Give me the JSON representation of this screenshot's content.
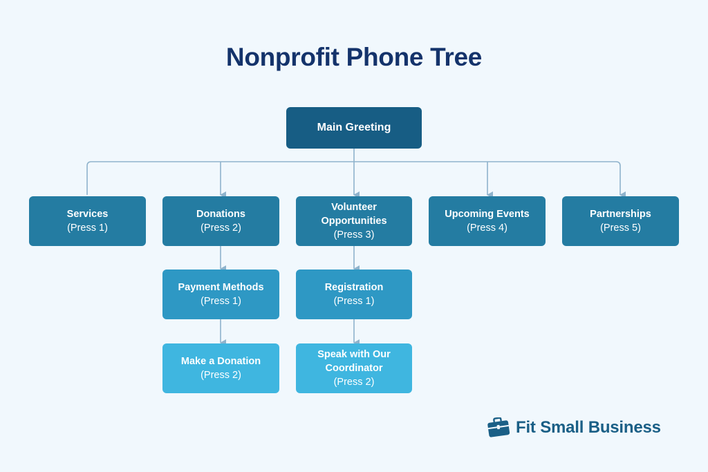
{
  "title": "Nonprofit Phone Tree",
  "colors": {
    "background": "#f1f8fd",
    "title": "#14336b",
    "root": "#175d84",
    "level1": "#247ca2",
    "level2": "#2e98c4",
    "level3": "#3fb6e0",
    "connector": "#8fb3cc"
  },
  "root": {
    "label": "Main Greeting"
  },
  "options": [
    {
      "label": "Services",
      "press": "(Press 1)"
    },
    {
      "label": "Donations",
      "press": "(Press 2)"
    },
    {
      "label": "Volunteer Opportunities",
      "press": "(Press 3)"
    },
    {
      "label": "Upcoming Events",
      "press": "(Press 4)"
    },
    {
      "label": "Partnerships",
      "press": "(Press 5)"
    }
  ],
  "donations_sub": [
    {
      "label": "Payment Methods",
      "press": "(Press 1)"
    },
    {
      "label": "Make a Donation",
      "press": "(Press 2)"
    }
  ],
  "volunteer_sub": [
    {
      "label": "Registration",
      "press": "(Press 1)"
    },
    {
      "label": "Speak with Our Coordinator",
      "press": "(Press 2)"
    }
  ],
  "brand": {
    "name": "Fit Small Business",
    "icon": "briefcase-icon"
  }
}
